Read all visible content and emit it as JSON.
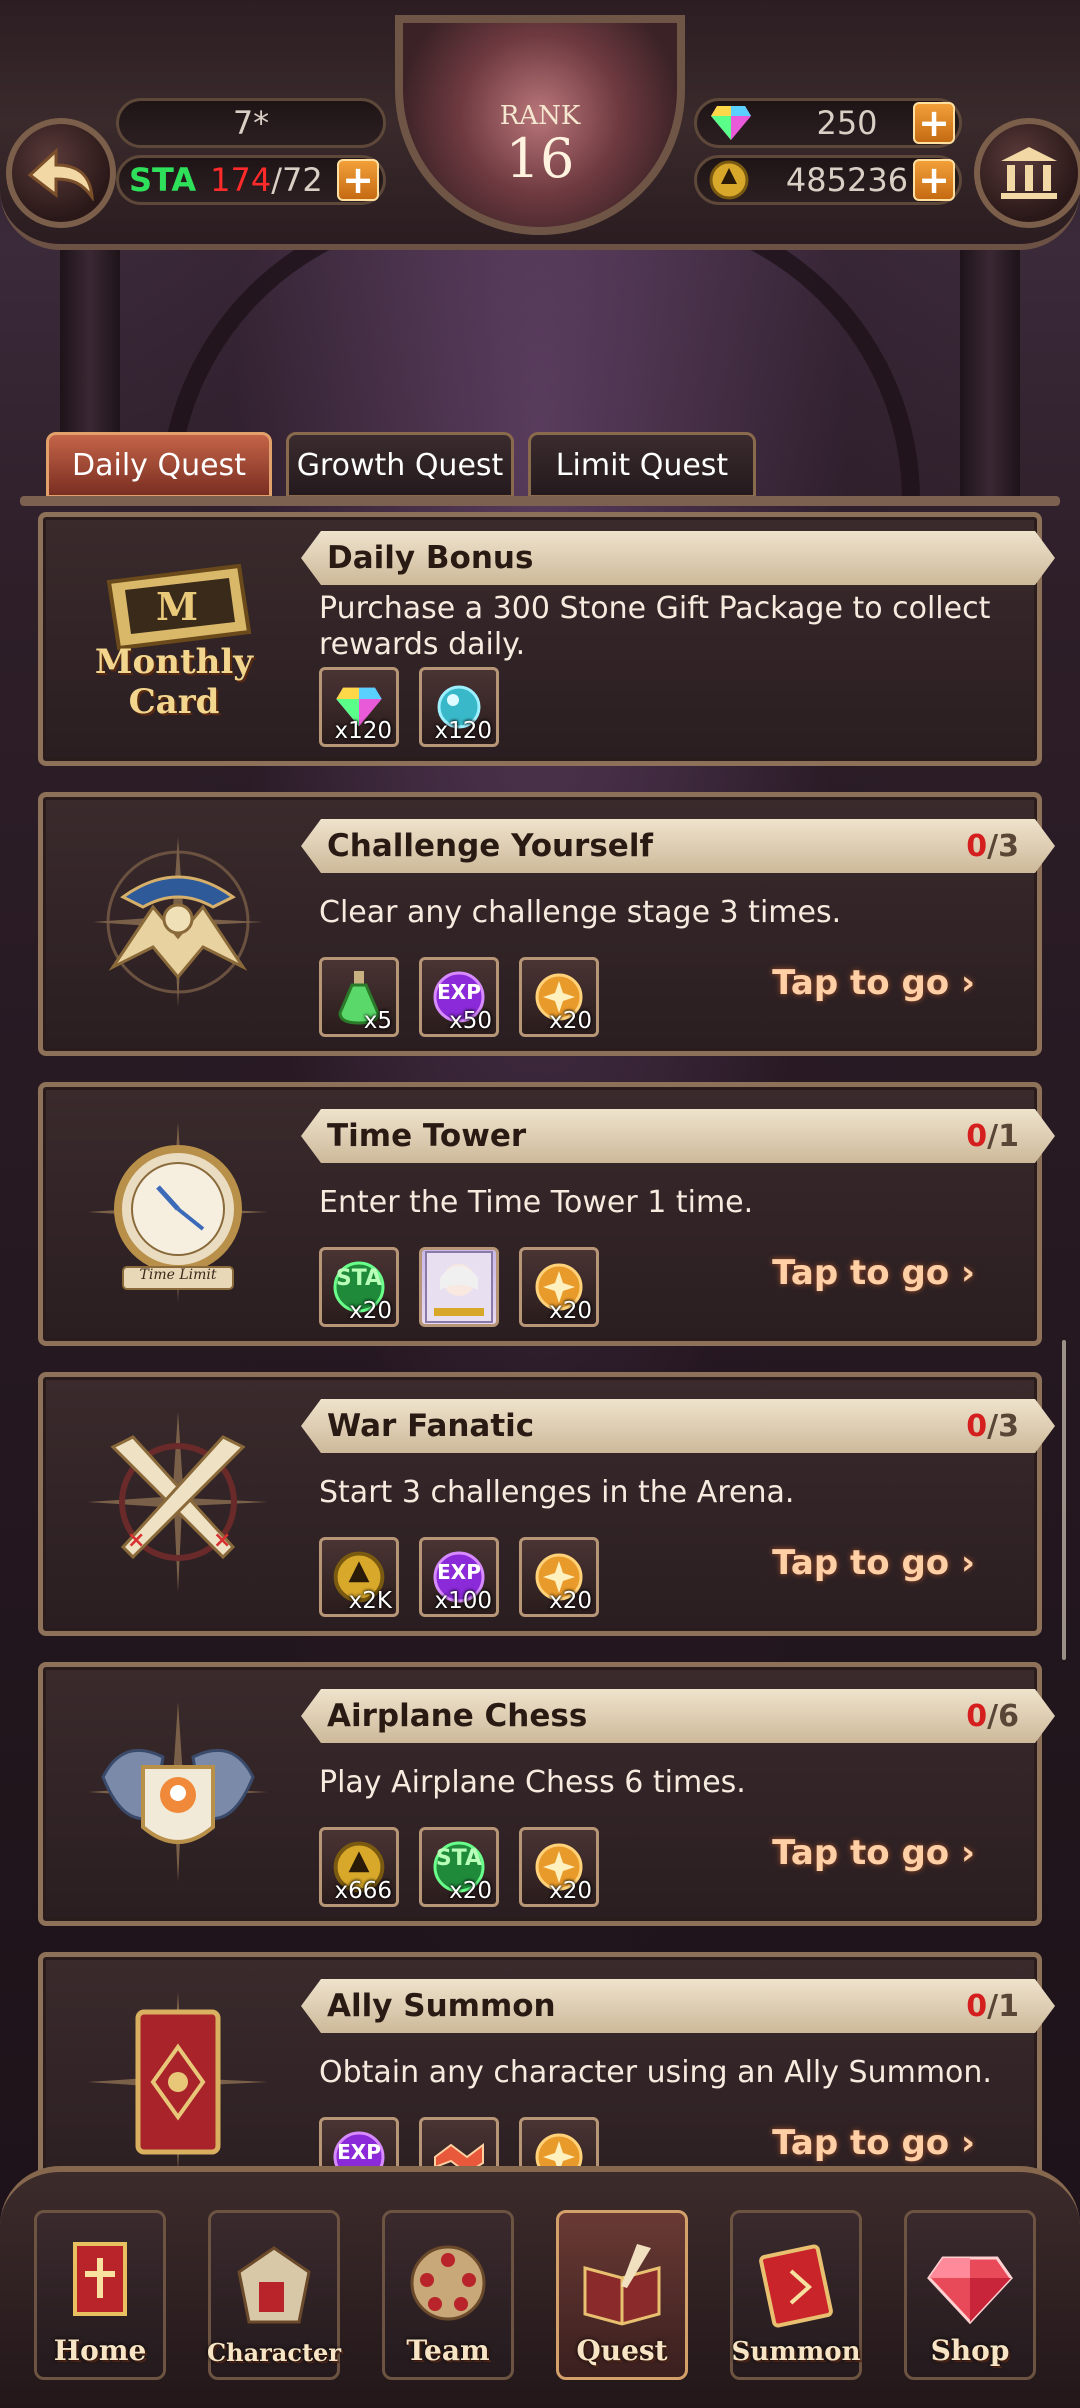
{
  "header": {
    "player_level": "7*",
    "sta_label": "STA",
    "sta_current": "174",
    "sta_max": "/72",
    "rank_label": "RANK",
    "rank_value": "16",
    "gems": "250",
    "gold": "485236",
    "colors": {
      "sta_green": "#2ee05a",
      "sta_red": "#ff2a2a",
      "plus_orange": "#e08a24"
    }
  },
  "tabs": [
    {
      "label": "Daily Quest",
      "active": true
    },
    {
      "label": "Growth Quest",
      "active": false
    },
    {
      "label": "Limit Quest",
      "active": false
    }
  ],
  "monthly": {
    "badge_line1": "Monthly",
    "badge_line2": "Card",
    "title": "Daily Bonus",
    "desc": "Purchase a 300 Stone Gift Package to collect rewards daily.",
    "rewards": [
      {
        "icon": "rainbow-gem-icon",
        "qty": "x120"
      },
      {
        "icon": "blue-orb-icon",
        "qty": "x120"
      }
    ]
  },
  "quests": [
    {
      "title": "Challenge Yourself",
      "cur": "0",
      "total": "/3",
      "desc": "Clear any challenge stage 3 times.",
      "go": "Tap to go",
      "rewards": [
        {
          "icon": "green-potion-icon",
          "label": "",
          "qty": "x5"
        },
        {
          "icon": "exp-orb-icon",
          "label": "EXP",
          "qty": "x50"
        },
        {
          "icon": "gold-medal-icon",
          "label": "",
          "qty": "x20"
        }
      ]
    },
    {
      "title": "Time Tower",
      "cur": "0",
      "total": "/1",
      "desc": "Enter the Time Tower 1 time.",
      "go": "Tap to go",
      "emblem_text": "Time Limit",
      "rewards": [
        {
          "icon": "sta-orb-icon",
          "label": "STA",
          "qty": "x20"
        },
        {
          "icon": "character-card-icon",
          "label": "",
          "qty": ""
        },
        {
          "icon": "gold-medal-icon",
          "label": "",
          "qty": "x20"
        }
      ]
    },
    {
      "title": "War Fanatic",
      "cur": "0",
      "total": "/3",
      "desc": "Start 3 challenges in the Arena.",
      "go": "Tap to go",
      "rewards": [
        {
          "icon": "gold-coin-icon",
          "label": "",
          "qty": "x2K"
        },
        {
          "icon": "exp-orb-icon",
          "label": "EXP",
          "qty": "x100"
        },
        {
          "icon": "gold-medal-icon",
          "label": "",
          "qty": "x20"
        }
      ]
    },
    {
      "title": "Airplane Chess",
      "cur": "0",
      "total": "/6",
      "desc": "Play Airplane Chess 6 times.",
      "go": "Tap to go",
      "rewards": [
        {
          "icon": "gold-coin-icon",
          "label": "",
          "qty": "x666"
        },
        {
          "icon": "sta-orb-icon",
          "label": "STA",
          "qty": "x20"
        },
        {
          "icon": "gold-medal-icon",
          "label": "",
          "qty": "x20"
        }
      ]
    },
    {
      "title": "Ally Summon",
      "cur": "0",
      "total": "/1",
      "desc": "Obtain any character using an Ally Summon.",
      "go": "Tap to go",
      "rewards": [
        {
          "icon": "exp-orb-icon",
          "label": "EXP",
          "qty": ""
        },
        {
          "icon": "handshake-icon",
          "label": "",
          "qty": ""
        },
        {
          "icon": "gold-medal-icon",
          "label": "",
          "qty": ""
        }
      ]
    }
  ],
  "nav": [
    {
      "label": "Home",
      "icon": "home-banner-icon",
      "active": false
    },
    {
      "label": "Character",
      "icon": "character-icon",
      "active": false
    },
    {
      "label": "Team",
      "icon": "team-icon",
      "active": false
    },
    {
      "label": "Quest",
      "icon": "quest-book-icon",
      "active": true
    },
    {
      "label": "Summon",
      "icon": "summon-book-icon",
      "active": false
    },
    {
      "label": "Shop",
      "icon": "shop-diamond-icon",
      "active": false
    }
  ]
}
